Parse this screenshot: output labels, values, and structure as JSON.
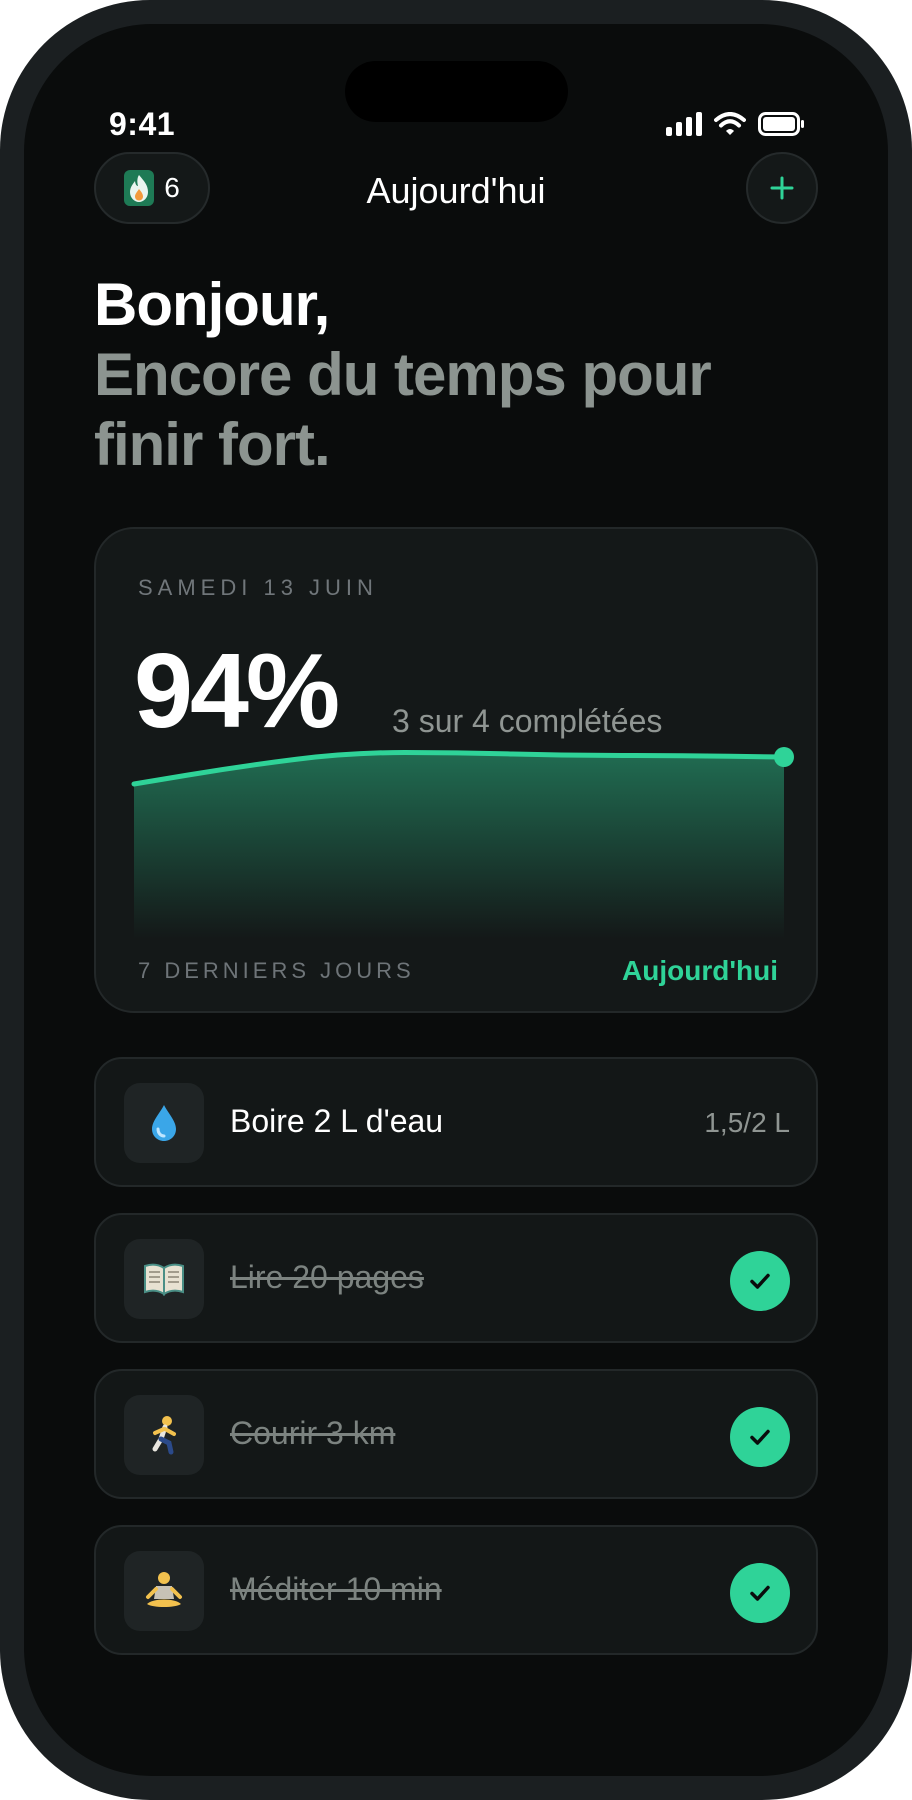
{
  "status_bar": {
    "time": "9:41",
    "icons": [
      "signal-icon",
      "wifi-icon",
      "battery-icon"
    ]
  },
  "header": {
    "streak_count": "6",
    "streak_icon": "flame-icon",
    "title": "Aujourd'hui",
    "add_icon": "plus-icon"
  },
  "greeting": {
    "title": "Bonjour,",
    "subtitle": "Encore du temps pour finir fort."
  },
  "summary": {
    "date": "SAMEDI 13 JUIN",
    "percent": "94%",
    "completed": "3 sur 4 complétées",
    "footer_left": "7 DERNIERS JOURS",
    "footer_right": "Aujourd'hui",
    "chart_data": {
      "type": "area",
      "points": 7,
      "values": [
        0.62,
        0.74,
        0.83,
        0.83,
        0.81,
        0.81,
        0.8
      ],
      "ylim": [
        0,
        1
      ],
      "highlight_last": true
    }
  },
  "habits": [
    {
      "icon": "water-drop-icon",
      "label": "Boire 2 L d'eau",
      "progress": "1,5/2 L",
      "done": false
    },
    {
      "icon": "book-icon",
      "label": "Lire 20 pages",
      "done": true
    },
    {
      "icon": "runner-icon",
      "label": "Courir 3 km",
      "done": true
    },
    {
      "icon": "meditation-icon",
      "label": "Méditer 10 min",
      "done": true
    }
  ],
  "colors": {
    "accent": "#2fd398",
    "background": "#0a0c0c",
    "card": "#141818",
    "muted_text": "#8c9490"
  }
}
